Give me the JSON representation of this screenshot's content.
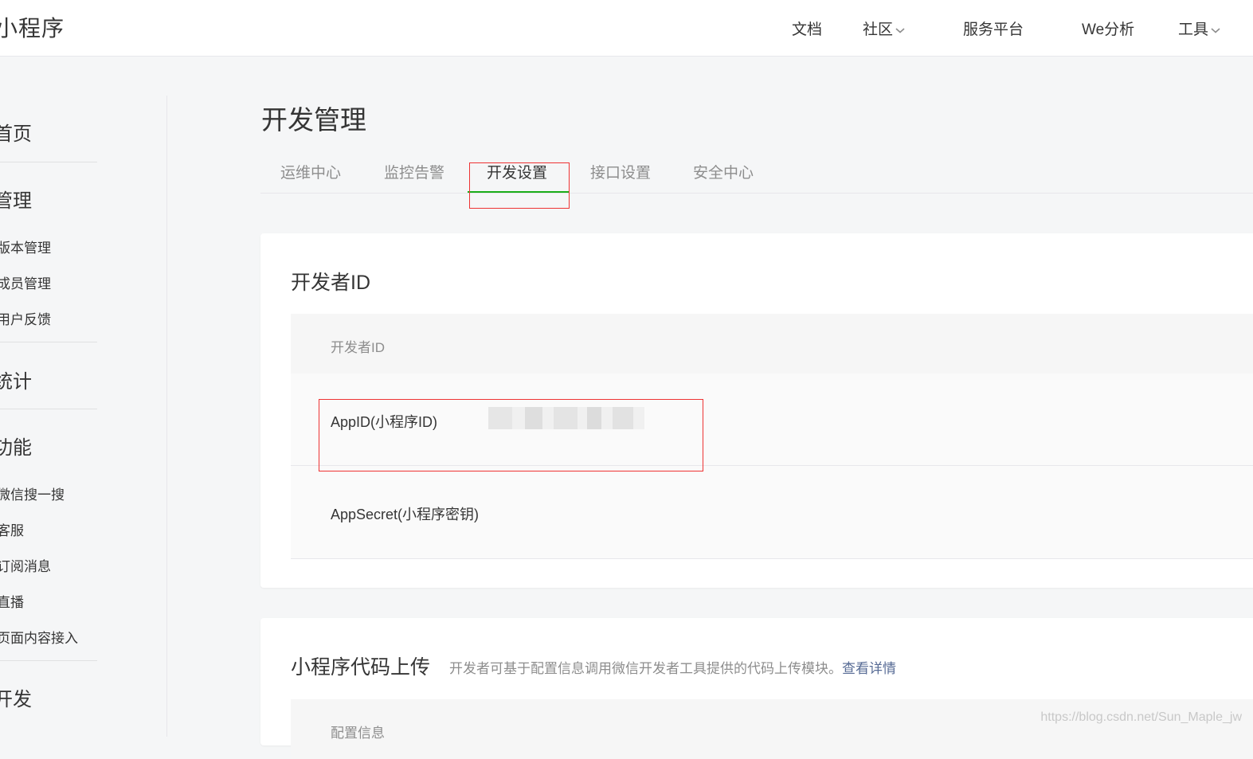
{
  "header": {
    "brand": "小程序",
    "nav": [
      {
        "label": "文档",
        "has_dropdown": false
      },
      {
        "label": "社区",
        "has_dropdown": true
      },
      {
        "label": "服务平台",
        "has_dropdown": false
      },
      {
        "label": "We分析",
        "has_dropdown": false
      },
      {
        "label": "工具",
        "has_dropdown": true
      }
    ]
  },
  "sidebar": {
    "items": [
      {
        "label": "首页",
        "kind": "group"
      },
      {
        "label": "管理",
        "kind": "group"
      },
      {
        "label": "版本管理",
        "kind": "item"
      },
      {
        "label": "成员管理",
        "kind": "item"
      },
      {
        "label": "用户反馈",
        "kind": "item"
      },
      {
        "label": "统计",
        "kind": "group"
      },
      {
        "label": "功能",
        "kind": "group"
      },
      {
        "label": "微信搜一搜",
        "kind": "item"
      },
      {
        "label": "客服",
        "kind": "item"
      },
      {
        "label": "订阅消息",
        "kind": "item"
      },
      {
        "label": "直播",
        "kind": "item"
      },
      {
        "label": "页面内容接入",
        "kind": "item"
      },
      {
        "label": "开发",
        "kind": "group"
      }
    ]
  },
  "main": {
    "title": "开发管理",
    "tabs": [
      {
        "label": "运维中心",
        "active": false
      },
      {
        "label": "监控告警",
        "active": false
      },
      {
        "label": "开发设置",
        "active": true
      },
      {
        "label": "接口设置",
        "active": false
      },
      {
        "label": "安全中心",
        "active": false
      }
    ],
    "developer_section": {
      "title": "开发者ID",
      "table_header": "开发者ID",
      "rows": [
        {
          "label": "AppID(小程序ID)",
          "value_state": "blurred"
        },
        {
          "label": "AppSecret(小程序密钥)",
          "value_state": "empty"
        }
      ]
    },
    "upload_section": {
      "title": "小程序代码上传",
      "description": "开发者可基于配置信息调用微信开发者工具提供的代码上传模块。",
      "link": "查看详情",
      "table_header": "配置信息"
    }
  },
  "watermark": "https://blog.csdn.net/Sun_Maple_jw",
  "colors": {
    "accent_green": "#1aad19",
    "highlight_red": "#ee3333",
    "link_blue": "#576b95",
    "page_bg": "#f5f6f7"
  }
}
